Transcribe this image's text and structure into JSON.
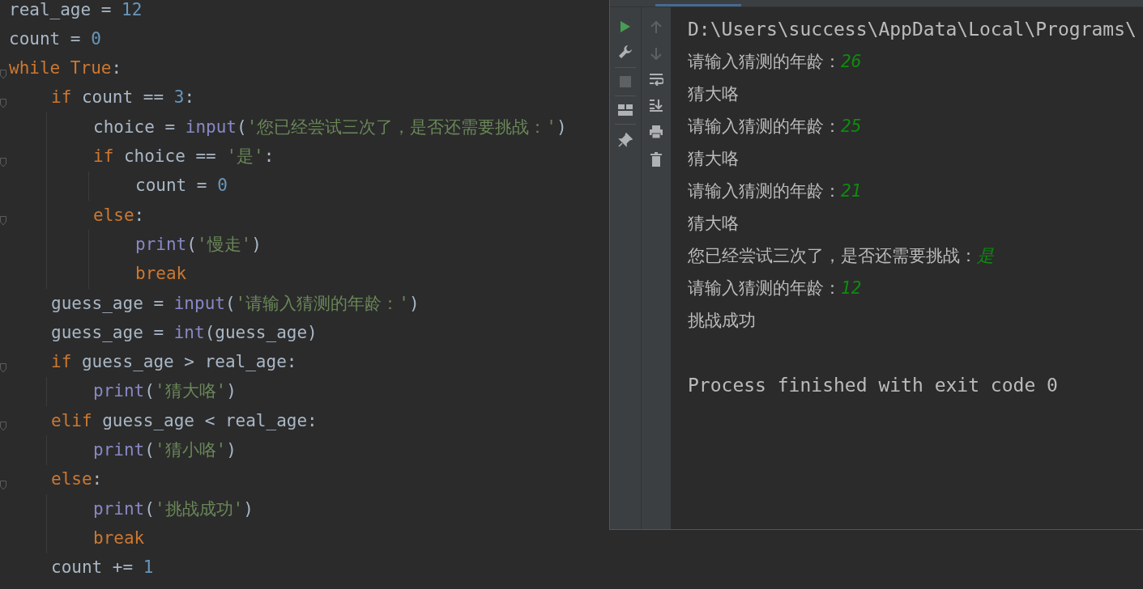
{
  "editor": {
    "lines": [
      {
        "tokens": [
          {
            "kind": "plain",
            "text": "real_age = "
          },
          {
            "kind": "number",
            "text": "12"
          }
        ]
      },
      {
        "tokens": [
          {
            "kind": "plain",
            "text": "count = "
          },
          {
            "kind": "number",
            "text": "0"
          }
        ]
      },
      {
        "tokens": [
          {
            "kind": "keyword",
            "text": "while True"
          },
          {
            "kind": "plain",
            "text": ":"
          }
        ],
        "children": [
          {
            "tokens": [
              {
                "kind": "keyword",
                "text": "if "
              },
              {
                "kind": "plain",
                "text": "count == "
              },
              {
                "kind": "number",
                "text": "3"
              },
              {
                "kind": "plain",
                "text": ":"
              }
            ],
            "children": [
              {
                "tokens": [
                  {
                    "kind": "plain",
                    "text": "choice = "
                  },
                  {
                    "kind": "builtin",
                    "text": "input"
                  },
                  {
                    "kind": "plain",
                    "text": "("
                  },
                  {
                    "kind": "string",
                    "text": "'您已经尝试三次了，是否还需要挑战：'"
                  },
                  {
                    "kind": "plain",
                    "text": ")"
                  }
                ]
              },
              {
                "tokens": [
                  {
                    "kind": "keyword",
                    "text": "if "
                  },
                  {
                    "kind": "plain",
                    "text": "choice == "
                  },
                  {
                    "kind": "string",
                    "text": "'是'"
                  },
                  {
                    "kind": "plain",
                    "text": ":"
                  }
                ],
                "children": [
                  {
                    "tokens": [
                      {
                        "kind": "plain",
                        "text": "count = "
                      },
                      {
                        "kind": "number",
                        "text": "0"
                      }
                    ]
                  }
                ]
              },
              {
                "tokens": [
                  {
                    "kind": "keyword",
                    "text": "else"
                  },
                  {
                    "kind": "plain",
                    "text": ":"
                  }
                ],
                "children": [
                  {
                    "tokens": [
                      {
                        "kind": "builtin",
                        "text": "print"
                      },
                      {
                        "kind": "plain",
                        "text": "("
                      },
                      {
                        "kind": "string",
                        "text": "'慢走'"
                      },
                      {
                        "kind": "plain",
                        "text": ")"
                      }
                    ]
                  },
                  {
                    "tokens": [
                      {
                        "kind": "keyword",
                        "text": "break"
                      }
                    ]
                  }
                ]
              }
            ]
          },
          {
            "tokens": [
              {
                "kind": "plain",
                "text": "guess_age = "
              },
              {
                "kind": "builtin",
                "text": "input"
              },
              {
                "kind": "plain",
                "text": "("
              },
              {
                "kind": "string",
                "text": "'请输入猜测的年龄：'"
              },
              {
                "kind": "plain",
                "text": ")"
              }
            ]
          },
          {
            "tokens": [
              {
                "kind": "plain",
                "text": "guess_age = "
              },
              {
                "kind": "builtin",
                "text": "int"
              },
              {
                "kind": "plain",
                "text": "(guess_age)"
              }
            ]
          },
          {
            "tokens": [
              {
                "kind": "keyword",
                "text": "if "
              },
              {
                "kind": "plain",
                "text": "guess_age > real_age:"
              }
            ],
            "children": [
              {
                "tokens": [
                  {
                    "kind": "builtin",
                    "text": "print"
                  },
                  {
                    "kind": "plain",
                    "text": "("
                  },
                  {
                    "kind": "string",
                    "text": "'猜大咯'"
                  },
                  {
                    "kind": "plain",
                    "text": ")"
                  }
                ]
              }
            ]
          },
          {
            "tokens": [
              {
                "kind": "keyword",
                "text": "elif "
              },
              {
                "kind": "plain",
                "text": "guess_age < real_age:"
              }
            ],
            "children": [
              {
                "tokens": [
                  {
                    "kind": "builtin",
                    "text": "print"
                  },
                  {
                    "kind": "plain",
                    "text": "("
                  },
                  {
                    "kind": "string",
                    "text": "'猜小咯'"
                  },
                  {
                    "kind": "plain",
                    "text": ")"
                  }
                ]
              }
            ]
          },
          {
            "tokens": [
              {
                "kind": "keyword",
                "text": "else"
              },
              {
                "kind": "plain",
                "text": ":"
              }
            ],
            "children": [
              {
                "tokens": [
                  {
                    "kind": "builtin",
                    "text": "print"
                  },
                  {
                    "kind": "plain",
                    "text": "("
                  },
                  {
                    "kind": "string",
                    "text": "'挑战成功'"
                  },
                  {
                    "kind": "plain",
                    "text": ")"
                  }
                ]
              },
              {
                "tokens": [
                  {
                    "kind": "keyword",
                    "text": "break"
                  }
                ]
              }
            ]
          },
          {
            "tokens": [
              {
                "kind": "plain",
                "text": "count += "
              },
              {
                "kind": "number",
                "text": "1"
              }
            ]
          }
        ]
      }
    ]
  },
  "run_console": {
    "lines": [
      {
        "kind": "command",
        "text": "D:\\Users\\success\\AppData\\Local\\Programs\\"
      },
      {
        "kind": "prompt",
        "text": "请输入猜测的年龄：",
        "input": "26"
      },
      {
        "kind": "output",
        "text": "猜大咯"
      },
      {
        "kind": "prompt",
        "text": "请输入猜测的年龄：",
        "input": "25"
      },
      {
        "kind": "output",
        "text": "猜大咯"
      },
      {
        "kind": "prompt",
        "text": "请输入猜测的年龄：",
        "input": "21"
      },
      {
        "kind": "output",
        "text": "猜大咯"
      },
      {
        "kind": "prompt",
        "text": "您已经尝试三次了，是否还需要挑战：",
        "input": "是"
      },
      {
        "kind": "prompt",
        "text": "请输入猜测的年龄：",
        "input": "12"
      },
      {
        "kind": "output",
        "text": "挑战成功"
      },
      {
        "kind": "exit",
        "text": "Process finished with exit code 0"
      }
    ]
  }
}
